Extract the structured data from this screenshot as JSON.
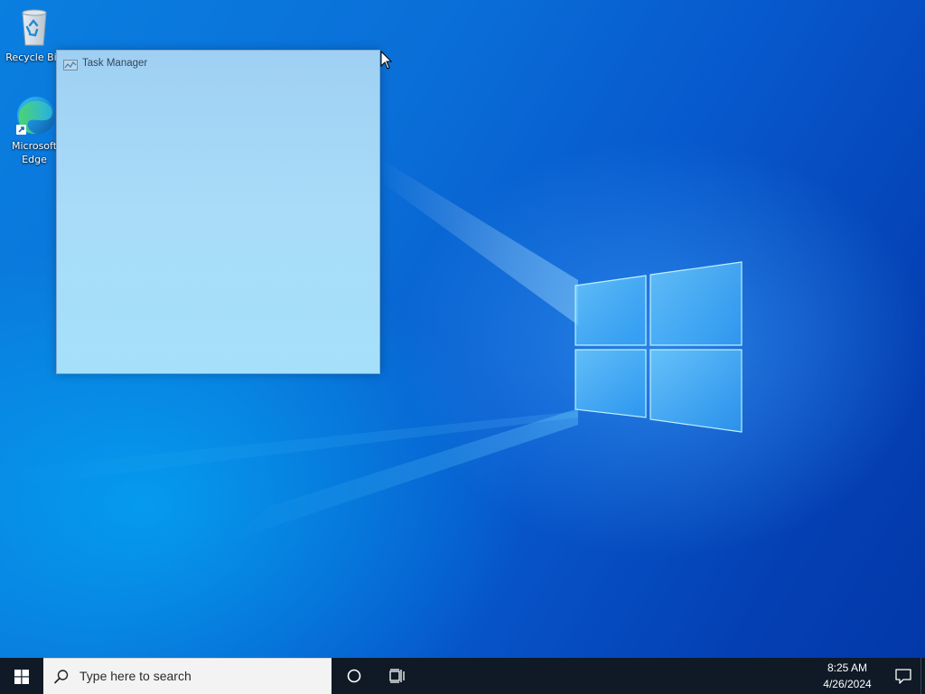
{
  "desktop": {
    "icons": [
      {
        "label": "Recycle Bin",
        "icon": "recycle-bin-icon"
      },
      {
        "label": "Microsoft Edge",
        "icon": "edge-icon"
      }
    ]
  },
  "window": {
    "title": "Task Manager",
    "icon": "task-manager-icon"
  },
  "taskbar": {
    "start_icon": "windows-start-icon",
    "search_placeholder": "Type here to search",
    "cortana_icon": "cortana-circle-icon",
    "taskview_icon": "task-view-icon",
    "time": "8:25 AM",
    "date": "4/26/2024",
    "notification_icon": "action-center-icon"
  },
  "colors": {
    "taskbar_bg": "#0f1a26",
    "search_bg": "#f3f3f3",
    "wallpaper_blue": "#0a6fd8"
  }
}
